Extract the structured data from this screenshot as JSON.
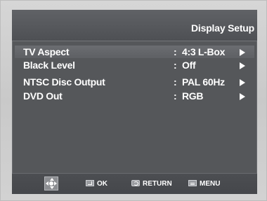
{
  "header": {
    "title": "Display Setup"
  },
  "menu": {
    "items": [
      {
        "label": "TV Aspect",
        "separator": ":",
        "value": "4:3 L-Box",
        "selected": true
      },
      {
        "label": "Black Level",
        "separator": ":",
        "value": "Off",
        "selected": false
      },
      {
        "label": "NTSC Disc Output",
        "separator": ":",
        "value": "PAL 60Hz",
        "selected": false
      },
      {
        "label": "DVD Out",
        "separator": ":",
        "value": "RGB",
        "selected": false
      }
    ]
  },
  "footer": {
    "ok_label": "OK",
    "return_label": "RETURN",
    "menu_label": "MENU"
  },
  "icons": {
    "nav": "dpad-icon",
    "ok": "ok-button-icon",
    "return": "return-button-icon",
    "menu": "menu-button-icon",
    "arrow": "right-arrow-icon"
  },
  "colors": {
    "background": "#55575a",
    "selected_row": "#666a6e",
    "text": "#ffffff",
    "frame": "#cfcfcf"
  }
}
